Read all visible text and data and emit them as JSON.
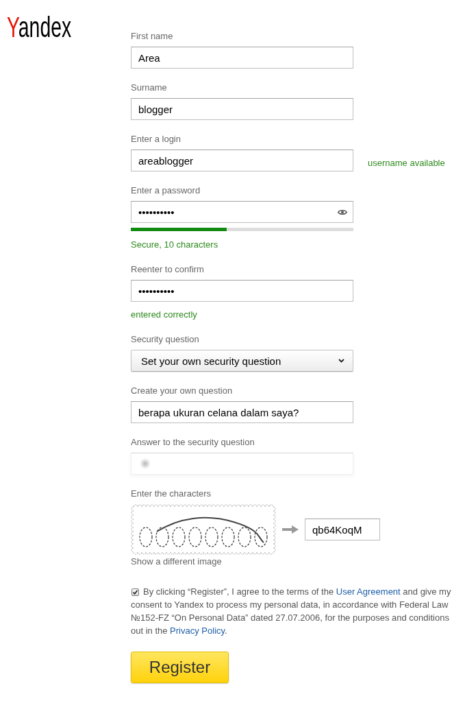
{
  "logo": "Yandex",
  "fields": [
    {
      "kind": "input",
      "label": "First name",
      "value": "Area"
    },
    {
      "kind": "input",
      "label": "Surname",
      "value": "blogger"
    },
    {
      "kind": "input",
      "label": "Enter a login",
      "value": "areablogger",
      "side_note": "username available"
    },
    {
      "kind": "input",
      "label": "Enter a password",
      "value": "••••••••••",
      "reveal_toggle": true,
      "strength": {
        "level": 0.43
      },
      "note": "Secure, 10 characters"
    },
    {
      "kind": "input",
      "label": "Reenter to confirm",
      "value": "••••••••••",
      "note": "entered correctly"
    },
    {
      "kind": "select",
      "label": "Security question",
      "value": "Set your own security question"
    },
    {
      "kind": "input",
      "label": "Create your own question",
      "value": "berapa ukuran celana dalam saya?"
    },
    {
      "kind": "input",
      "label": "Answer to the security question",
      "blurred": true
    },
    {
      "kind": "captcha",
      "label": "Enter the characters",
      "value": "qb64KoqM",
      "link": "Show a different image"
    }
  ],
  "agreement": {
    "checked": true,
    "parts": [
      {
        "kind": "text",
        "text": "By clicking “Register”, I agree to the terms of the "
      },
      {
        "kind": "link",
        "text": "User Agreement"
      },
      {
        "kind": "text",
        "text": " and give my consent to Yandex to process my personal data, in accordance with Federal Law №152-FZ “On Personal Data” dated 27.07.2006, for the purposes and conditions out in the "
      },
      {
        "kind": "link",
        "text": "Privacy Policy"
      },
      {
        "kind": "text",
        "text": "."
      }
    ]
  },
  "button": "Register"
}
